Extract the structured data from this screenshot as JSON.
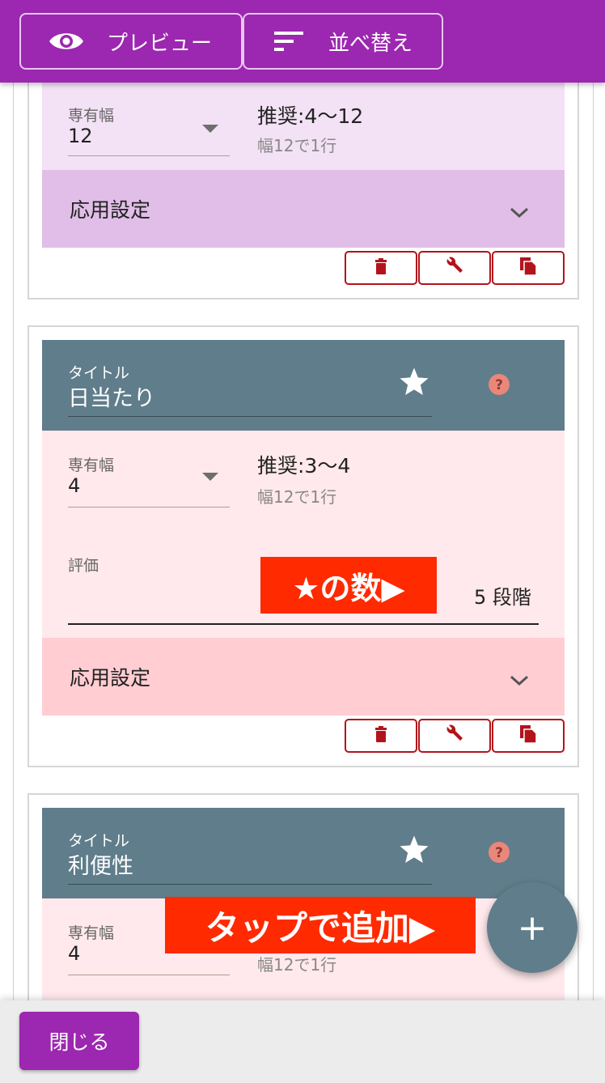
{
  "toolbar": {
    "preview_label": "プレビュー",
    "sort_label": "並べ替え"
  },
  "cards": [
    {
      "width_label": "専有幅",
      "width_value": "12",
      "recommend": "推奨:4〜12",
      "recommend_sub": "幅12で1行",
      "advanced_label": "応用設定"
    },
    {
      "title_caption": "タイトル",
      "title_value": "日当たり",
      "width_label": "専有幅",
      "width_value": "4",
      "recommend": "推奨:3〜4",
      "recommend_sub": "幅12で1行",
      "rating_label": "評価",
      "rating_value": "5 段階",
      "advanced_label": "応用設定"
    },
    {
      "title_caption": "タイトル",
      "title_value": "利便性",
      "width_label": "専有幅",
      "width_value": "4",
      "recommend_sub": "幅12で1行"
    }
  ],
  "annotations": {
    "star_count": "★の数▶",
    "tap_to_add": "タップで追加▶"
  },
  "fab_label": "+",
  "footer": {
    "close_label": "閉じる"
  },
  "icons": [
    "eye-icon",
    "sort-icon",
    "star-icon",
    "help-icon",
    "chevron-down-icon",
    "trash-icon",
    "wrench-icon",
    "copy-icon",
    "plus-icon"
  ],
  "colors": {
    "primary": "#9c27b0",
    "title_bar": "#607d8b",
    "card_bg_pink": "#ffe9ec",
    "card_bg_purple": "#f3e1f5",
    "advanced_pink": "#ffcdd2",
    "advanced_purple": "#e1bee7",
    "action_red": "#b3141b",
    "promo_red": "#ff2a00"
  }
}
